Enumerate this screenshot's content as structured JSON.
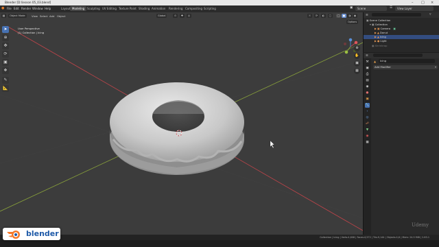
{
  "window": {
    "title": "Blender [D:\\lesson 05_03.blend]"
  },
  "menu": [
    "File",
    "Edit",
    "Render",
    "Window",
    "Help"
  ],
  "workspaces": [
    {
      "label": "Layout",
      "active": false
    },
    {
      "label": "Modeling",
      "active": true
    },
    {
      "label": "Sculpting",
      "active": false
    },
    {
      "label": "UV Editing",
      "active": false
    },
    {
      "label": "Texture Paint",
      "active": false
    },
    {
      "label": "Shading",
      "active": false
    },
    {
      "label": "Animation",
      "active": false
    },
    {
      "label": "Rendering",
      "active": false
    },
    {
      "label": "Compositing",
      "active": false
    },
    {
      "label": "Scripting",
      "active": false
    }
  ],
  "scene": {
    "scene_name": "Scene",
    "view_layer": "View Layer"
  },
  "viewport": {
    "mode": "Object Mode",
    "menus": [
      "View",
      "Select",
      "Add",
      "Object"
    ],
    "transform": "Global",
    "perspective_label": "User Perspective",
    "collection_label": "(1) Collection | Icing",
    "options_label": "Options"
  },
  "outliner": {
    "rows": [
      {
        "label": "Scene Collection",
        "indent": 0
      },
      {
        "label": "Collection",
        "indent": 1
      },
      {
        "label": "Camera",
        "indent": 2
      },
      {
        "label": "Donut",
        "indent": 2
      },
      {
        "label": "Icing",
        "indent": 2
      },
      {
        "label": "Light",
        "indent": 2
      },
      {
        "label": "Shrinkrap",
        "indent": 1
      }
    ]
  },
  "properties": {
    "object_name": "Icing",
    "add_modifier_label": "Add Modifier"
  },
  "status": {
    "stats": "Collection | Icing | Verts:4,608 | Faces:4,572 | Tris:9,144 | Objects:1/4 | Mem: 24.5 MiB | 2.83.1"
  },
  "branding": {
    "badge_text": "blender",
    "watermark": "Udemy"
  },
  "colors": {
    "accent": "#4772b3",
    "viewport_bg": "#3c3c3c",
    "x_axis": "#c0444a",
    "y_axis": "#8aa33b"
  }
}
